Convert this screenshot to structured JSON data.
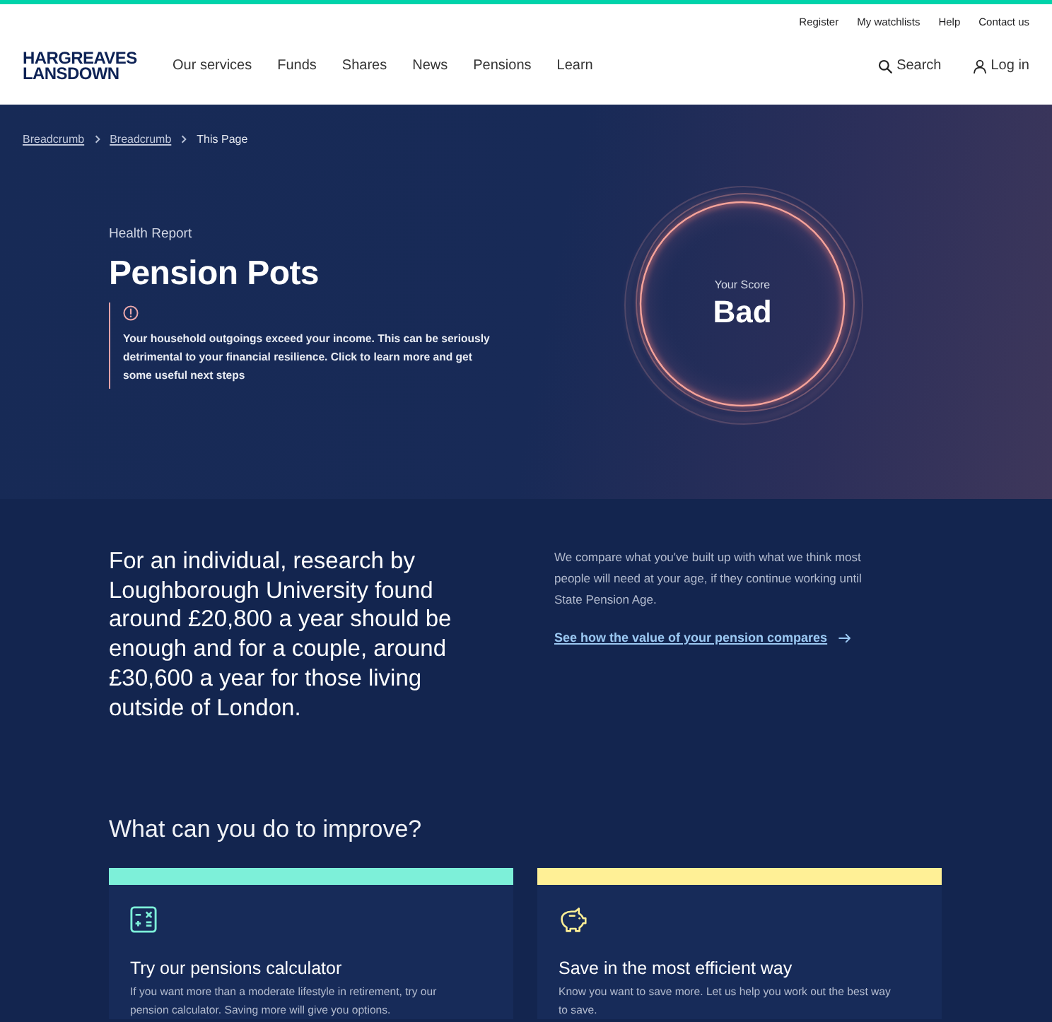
{
  "top_links": [
    "Register",
    "My watchlists",
    "Help",
    "Contact us"
  ],
  "header": {
    "logo": [
      "HARGREAVES",
      "LANSDOWN"
    ],
    "nav": [
      "Our services",
      "Funds",
      "Shares",
      "News",
      "Pensions",
      "Learn"
    ],
    "search": "Search",
    "login": "Log in"
  },
  "breadcrumb": [
    {
      "label": "Breadcrumb",
      "current": false
    },
    {
      "label": "Breadcrumb",
      "current": false
    },
    {
      "label": "This Page",
      "current": true
    }
  ],
  "hero": {
    "eyebrow": "Health Report",
    "title": "Pension Pots",
    "alert": "Your household outgoings exceed your income. This can be seriously detrimental to your financial resilience. Click to learn more and get some useful next steps",
    "score": {
      "label": "Your Score",
      "value": "Bad"
    }
  },
  "research": {
    "statement": "For an individual, research by Loughborough University found around £20,800 a year should be enough and for a couple, around £30,600 a year for those living outside of London.",
    "description": "We compare what you've built up with what we think most people will need at your age, if they continue working until State Pension Age.",
    "link": "See how the value of your pension compares"
  },
  "improve": {
    "heading": "What can you do to improve?",
    "cards": [
      {
        "kind": "calculator",
        "color": "#7df0d9",
        "title": "Try our pensions calculator",
        "text": "If you want more than a moderate lifestyle in retirement, try our pension calculator. Saving more will give you options."
      },
      {
        "kind": "savings",
        "color": "#fff096",
        "title": "Save in the most efficient way",
        "text": "Know you want to save more. Let us help you work out the best way to save."
      }
    ]
  }
}
